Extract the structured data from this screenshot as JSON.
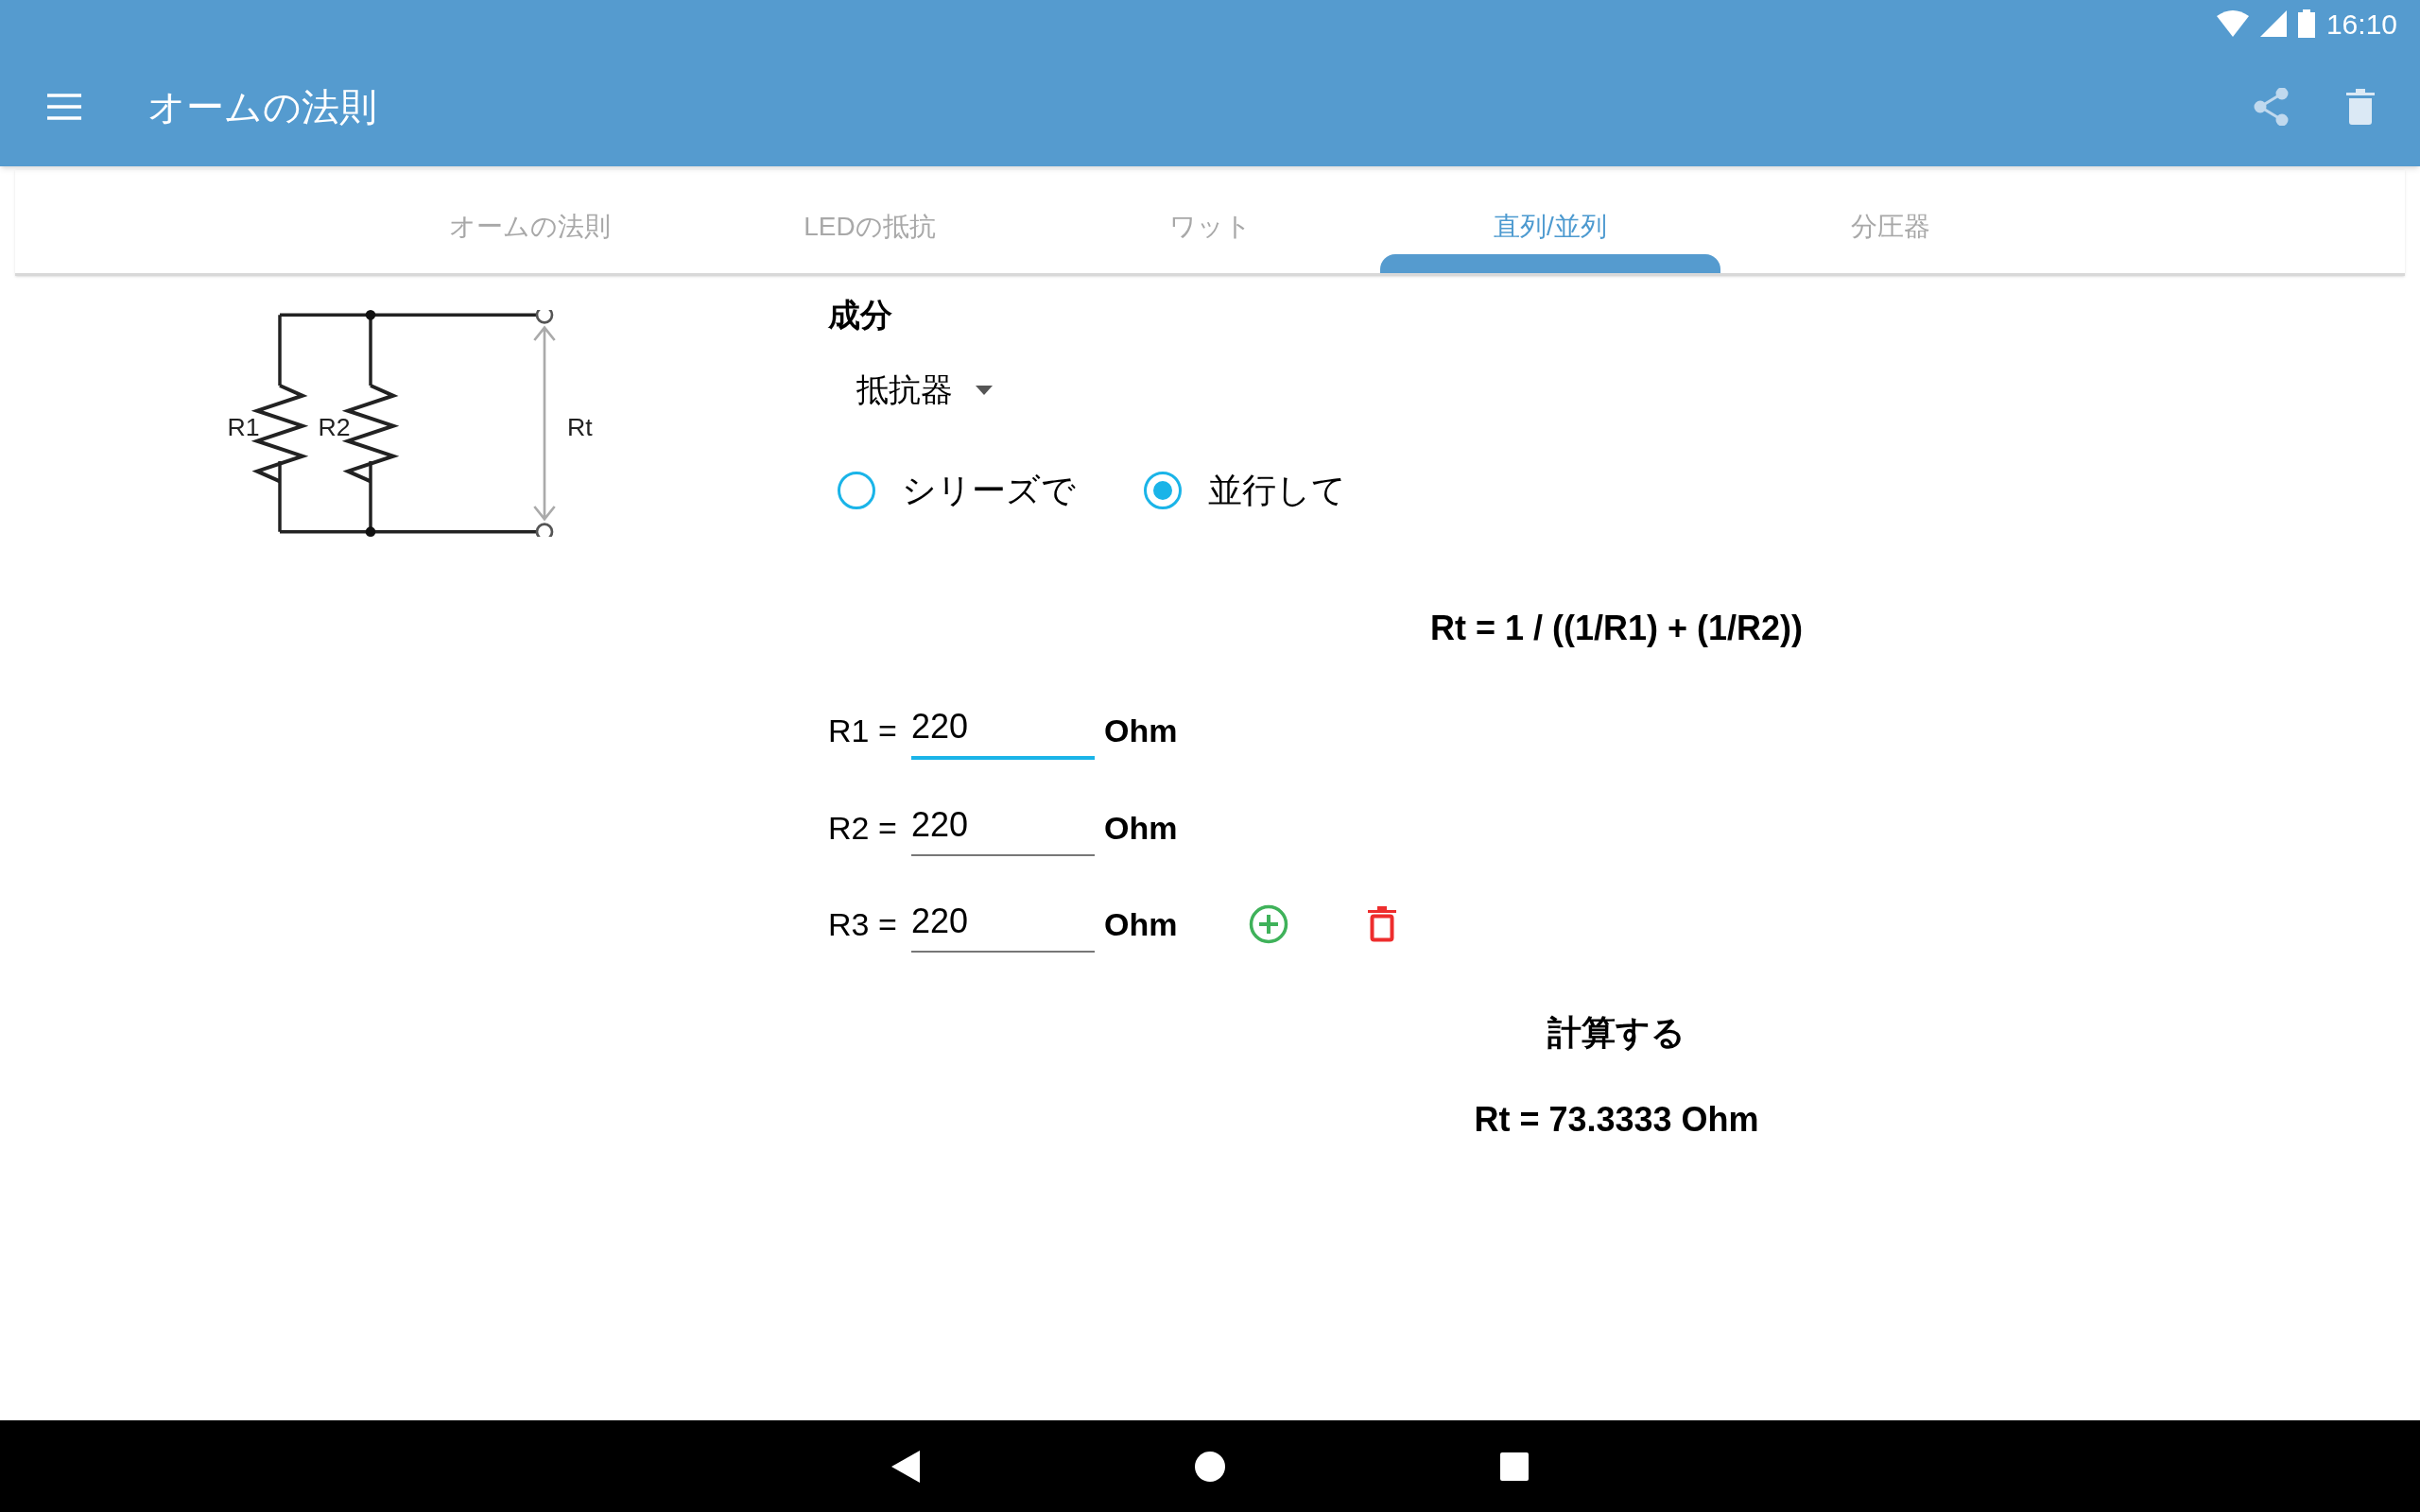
{
  "status_bar": {
    "time": "16:10"
  },
  "app_bar": {
    "title": "オームの法則"
  },
  "tabs": [
    {
      "label": "オームの法則",
      "selected": false
    },
    {
      "label": "LEDの抵抗",
      "selected": false
    },
    {
      "label": "ワット",
      "selected": false
    },
    {
      "label": "直列/並列",
      "selected": true
    },
    {
      "label": "分圧器",
      "selected": false
    }
  ],
  "diagram": {
    "labels": [
      "R1",
      "R2",
      "Rt"
    ]
  },
  "component": {
    "label": "成分",
    "dropdown_value": "抵抗器"
  },
  "connection": [
    {
      "label": "シリーズで",
      "selected": false
    },
    {
      "label": "並行して",
      "selected": true
    }
  ],
  "formula": "Rt = 1 / ((1/R1) + (1/R2))",
  "resistors": [
    {
      "label": "R1 =",
      "value": "220",
      "unit": "Ohm",
      "focused": true
    },
    {
      "label": "R2 =",
      "value": "220",
      "unit": "Ohm",
      "focused": false
    },
    {
      "label": "R3 =",
      "value": "220",
      "unit": "Ohm",
      "focused": false
    }
  ],
  "calculate_button": "計算する",
  "result": "Rt = 73.3333 Ohm"
}
